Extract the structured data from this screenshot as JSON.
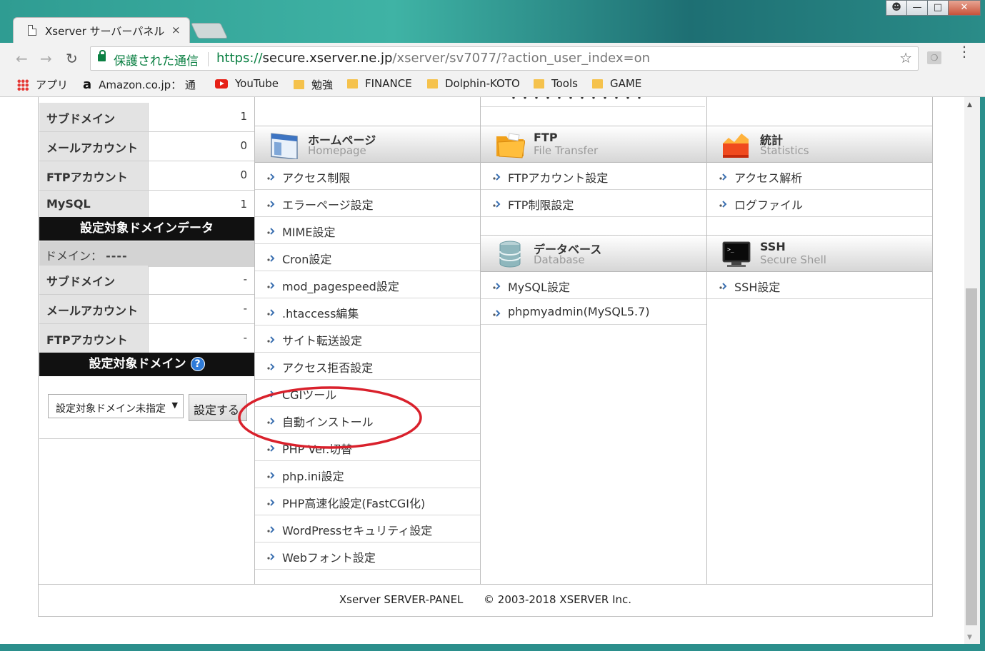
{
  "browser": {
    "tab_title": "Xserver サーバーパネル",
    "tab_close": "×",
    "secure_label": "保護された通信",
    "url_proto": "https://",
    "url_host": "secure.xserver.ne.jp",
    "url_path": "/xserver/sv7077/?action_user_index=on",
    "bookmarks": [
      {
        "label": "アプリ",
        "icon": "apps-grid-icon"
      },
      {
        "label": "Amazon.co.jp： 通",
        "icon": "amazon-icon"
      },
      {
        "label": "YouTube",
        "icon": "youtube-icon"
      },
      {
        "label": "勉強",
        "icon": "folder-icon"
      },
      {
        "label": "FINANCE",
        "icon": "folder-icon"
      },
      {
        "label": "Dolphin-KOTO",
        "icon": "folder-icon"
      },
      {
        "label": "Tools",
        "icon": "folder-icon"
      },
      {
        "label": "GAME",
        "icon": "folder-icon"
      }
    ]
  },
  "sidebar": {
    "top_rows": [
      {
        "label": "サブドメイン",
        "value": "1"
      },
      {
        "label": "メールアカウント",
        "value": "0"
      },
      {
        "label": "FTPアカウント",
        "value": "0"
      },
      {
        "label": "MySQL",
        "value": "1"
      }
    ],
    "target_data_header": "設定対象ドメインデータ",
    "domain_label": "ドメイン：",
    "domain_value": "----",
    "target_rows": [
      {
        "label": "サブドメイン",
        "value": "-"
      },
      {
        "label": "メールアカウント",
        "value": "-"
      },
      {
        "label": "FTPアカウント",
        "value": "-"
      }
    ],
    "target_domain_header": "設定対象ドメイン",
    "help_icon": "?",
    "select_value": "設定対象ドメイン未指定",
    "set_button": "設定する"
  },
  "panels": {
    "homepage": {
      "title": "ホームページ",
      "subtitle": "Homepage",
      "items": [
        "アクセス制限",
        "エラーページ設定",
        "MIME設定",
        "Cron設定",
        "mod_pagespeed設定",
        ".htaccess編集",
        "サイト転送設定",
        "アクセス拒否設定",
        "CGIツール",
        "自動インストール",
        "PHP Ver.切替",
        "php.ini設定",
        "PHP高速化設定(FastCGI化)",
        "WordPressセキュリティ設定",
        "Webフォント設定"
      ]
    },
    "ftp": {
      "title": "FTP",
      "subtitle": "File Transfer",
      "items": [
        "FTPアカウント設定",
        "FTP制限設定"
      ]
    },
    "stats": {
      "title": "統計",
      "subtitle": "Statistics",
      "items": [
        "アクセス解析",
        "ログファイル"
      ]
    },
    "database": {
      "title": "データベース",
      "subtitle": "Database",
      "items": [
        "MySQL設定",
        "phpmyadmin(MySQL5.7)"
      ]
    },
    "ssh": {
      "title": "SSH",
      "subtitle": "Secure Shell",
      "items": [
        "SSH設定"
      ]
    }
  },
  "footer": {
    "product": "Xserver SERVER-PANEL",
    "copyright": "© 2003-2018 XSERVER Inc."
  },
  "colors": {
    "secure_green": "#0b8043",
    "annotation_red": "#d9212c",
    "header_black": "#111111"
  }
}
